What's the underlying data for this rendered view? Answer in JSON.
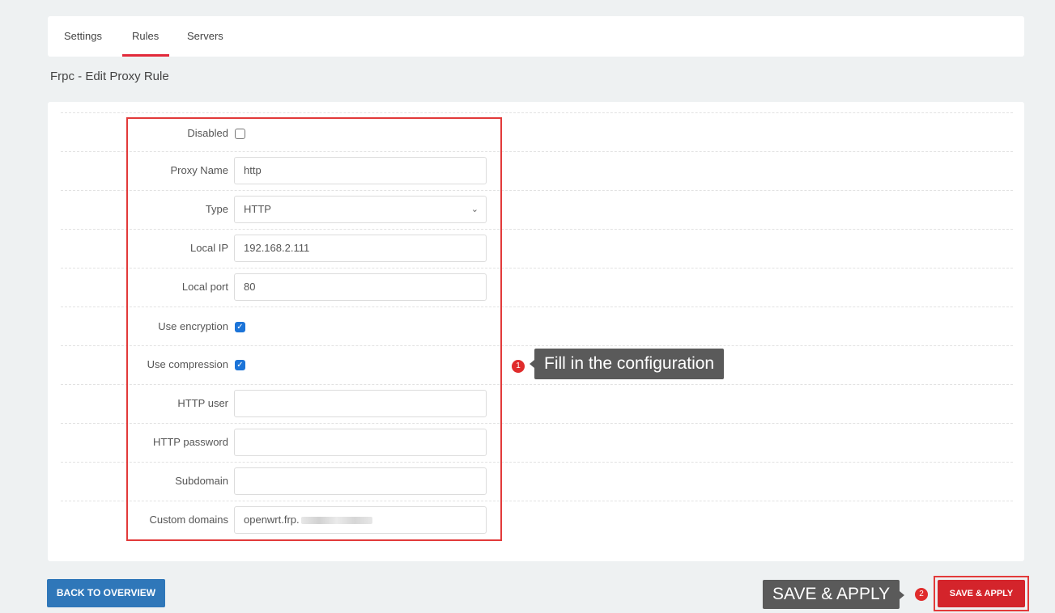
{
  "tabs": [
    {
      "label": "Settings",
      "active": false
    },
    {
      "label": "Rules",
      "active": true
    },
    {
      "label": "Servers",
      "active": false
    }
  ],
  "page_title": "Frpc - Edit Proxy Rule",
  "form": {
    "disabled": {
      "label": "Disabled",
      "checked": false
    },
    "proxy_name": {
      "label": "Proxy Name",
      "value": "http"
    },
    "type": {
      "label": "Type",
      "value": "HTTP"
    },
    "local_ip": {
      "label": "Local IP",
      "value": "192.168.2.111"
    },
    "local_port": {
      "label": "Local port",
      "value": "80"
    },
    "use_encryption": {
      "label": "Use encryption",
      "checked": true
    },
    "use_compression": {
      "label": "Use compression",
      "checked": true
    },
    "http_user": {
      "label": "HTTP user",
      "value": ""
    },
    "http_password": {
      "label": "HTTP password",
      "value": ""
    },
    "subdomain": {
      "label": "Subdomain",
      "value": ""
    },
    "custom_domains": {
      "label": "Custom domains",
      "value": "openwrt.frp."
    }
  },
  "annotations": {
    "step1_number": "1",
    "step1_text": "Fill in the configuration",
    "step2_number": "2",
    "step2_text": "SAVE & APPLY"
  },
  "buttons": {
    "back_label": "BACK TO OVERVIEW",
    "save_label": "SAVE & APPLY"
  },
  "icons": {
    "chevron": "chevron-down-icon",
    "check": "checkmark-icon"
  },
  "colors": {
    "accent_red": "#e2293a",
    "back_button": "#2f77b9",
    "save_button": "#d4242b",
    "checkbox_checked": "#1c74d8"
  }
}
